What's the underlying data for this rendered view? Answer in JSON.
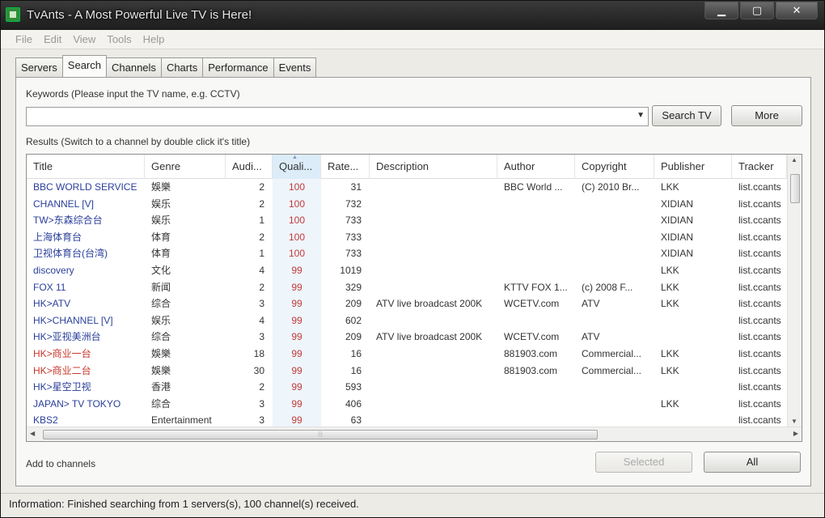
{
  "window": {
    "title": "TvAnts - A Most Powerful Live TV is Here!"
  },
  "menu": [
    "File",
    "Edit",
    "View",
    "Tools",
    "Help"
  ],
  "tabs": [
    "Servers",
    "Search",
    "Channels",
    "Charts",
    "Performance",
    "Events"
  ],
  "active_tab": "Search",
  "search": {
    "keywords_label": "Keywords (Please input the TV name, e.g. CCTV)",
    "input_value": "",
    "search_button": "Search TV",
    "more_button": "More",
    "results_label": "Results (Switch to a channel by double click it's title)"
  },
  "columns": [
    "Title",
    "Genre",
    "Audi...",
    "Quali...",
    "Rate...",
    "Description",
    "Author",
    "Copyright",
    "Publisher",
    "Tracker"
  ],
  "rows": [
    {
      "title": "BBC WORLD SERVICE",
      "red": false,
      "genre": "娛樂",
      "aud": "2",
      "qual": "100",
      "rate": "31",
      "desc": "",
      "author": "BBC World ...",
      "copyright": "(C) 2010 Br...",
      "publisher": "LKK",
      "tracker": "list.ccants"
    },
    {
      "title": "CHANNEL [V]",
      "red": false,
      "genre": "娱乐",
      "aud": "2",
      "qual": "100",
      "rate": "732",
      "desc": "",
      "author": "",
      "copyright": "",
      "publisher": "XIDIAN",
      "tracker": "list.ccants"
    },
    {
      "title": "TW>东森综合台",
      "red": false,
      "genre": "娱乐",
      "aud": "1",
      "qual": "100",
      "rate": "733",
      "desc": "",
      "author": "",
      "copyright": "",
      "publisher": "XIDIAN",
      "tracker": "list.ccants"
    },
    {
      "title": "上海体育台",
      "red": false,
      "genre": "体育",
      "aud": "2",
      "qual": "100",
      "rate": "733",
      "desc": "",
      "author": "",
      "copyright": "",
      "publisher": "XIDIAN",
      "tracker": "list.ccants"
    },
    {
      "title": "卫视体育台(台湾)",
      "red": false,
      "genre": "体育",
      "aud": "1",
      "qual": "100",
      "rate": "733",
      "desc": "",
      "author": "",
      "copyright": "",
      "publisher": "XIDIAN",
      "tracker": "list.ccants"
    },
    {
      "title": "discovery",
      "red": false,
      "genre": "文化",
      "aud": "4",
      "qual": "99",
      "rate": "1019",
      "desc": "",
      "author": "",
      "copyright": "",
      "publisher": "LKK",
      "tracker": "list.ccants"
    },
    {
      "title": "FOX 11",
      "red": false,
      "genre": "新闻",
      "aud": "2",
      "qual": "99",
      "rate": "329",
      "desc": "",
      "author": "KTTV FOX 1...",
      "copyright": "(c) 2008 F...",
      "publisher": "LKK",
      "tracker": "list.ccants"
    },
    {
      "title": "HK>ATV",
      "red": false,
      "genre": "综合",
      "aud": "3",
      "qual": "99",
      "rate": "209",
      "desc": "ATV live broadcast 200K",
      "author": "WCETV.com",
      "copyright": "ATV",
      "publisher": "LKK",
      "tracker": "list.ccants"
    },
    {
      "title": "HK>CHANNEL [V]",
      "red": false,
      "genre": "娱乐",
      "aud": "4",
      "qual": "99",
      "rate": "602",
      "desc": "",
      "author": "",
      "copyright": "",
      "publisher": "",
      "tracker": "list.ccants"
    },
    {
      "title": "HK>亚视美洲台",
      "red": false,
      "genre": "综合",
      "aud": "3",
      "qual": "99",
      "rate": "209",
      "desc": "ATV live broadcast 200K",
      "author": "WCETV.com",
      "copyright": "ATV",
      "publisher": "",
      "tracker": "list.ccants"
    },
    {
      "title": "HK>商业一台",
      "red": true,
      "genre": "娛樂",
      "aud": "18",
      "qual": "99",
      "rate": "16",
      "desc": "",
      "author": "881903.com",
      "copyright": "Commercial...",
      "publisher": "LKK",
      "tracker": "list.ccants"
    },
    {
      "title": "HK>商业二台",
      "red": true,
      "genre": "娛樂",
      "aud": "30",
      "qual": "99",
      "rate": "16",
      "desc": "",
      "author": "881903.com",
      "copyright": "Commercial...",
      "publisher": "LKK",
      "tracker": "list.ccants"
    },
    {
      "title": "HK>星空卫视",
      "red": false,
      "genre": "香港",
      "aud": "2",
      "qual": "99",
      "rate": "593",
      "desc": "",
      "author": "",
      "copyright": "",
      "publisher": "",
      "tracker": "list.ccants"
    },
    {
      "title": "JAPAN> TV TOKYO",
      "red": false,
      "genre": "综合",
      "aud": "3",
      "qual": "99",
      "rate": "406",
      "desc": "",
      "author": "",
      "copyright": "",
      "publisher": "LKK",
      "tracker": "list.ccants"
    },
    {
      "title": "KBS2",
      "red": false,
      "genre": "Entertainment",
      "aud": "3",
      "qual": "99",
      "rate": "63",
      "desc": "",
      "author": "",
      "copyright": "",
      "publisher": "",
      "tracker": "list.ccants"
    }
  ],
  "footer": {
    "add_label": "Add to channels",
    "selected_button": "Selected",
    "all_button": "All"
  },
  "status": "Information: Finished searching  from 1 servers(s), 100 channel(s) received.",
  "colors": {
    "title_blue": "#2a3f9a",
    "title_red": "#c8382c",
    "quality_red": "#c23a3a"
  }
}
